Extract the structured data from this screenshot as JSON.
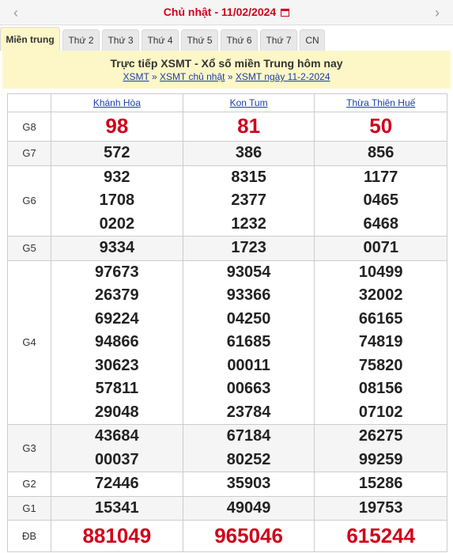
{
  "datebar": {
    "text": "Chủ nhật -  11/02/2024",
    "prev": "‹",
    "next": "›"
  },
  "tabs": [
    "Miền trung",
    "Thứ 2",
    "Thứ 3",
    "Thứ 4",
    "Thứ 5",
    "Thứ 6",
    "Thứ 7",
    "CN"
  ],
  "header": {
    "title": "Trực tiếp XSMT - Xổ số miền Trung hôm nay",
    "crumbs": [
      "XSMT",
      "XSMT chủ nhật",
      "XSMT ngày 11-2-2024"
    ],
    "sep": "»"
  },
  "provinces": [
    "Khánh Hòa",
    "Kon Tum",
    "Thừa Thiên Huế"
  ],
  "prizes": [
    {
      "label": "G8",
      "values": [
        [
          "98"
        ],
        [
          "81"
        ],
        [
          "50"
        ]
      ]
    },
    {
      "label": "G7",
      "values": [
        [
          "572"
        ],
        [
          "386"
        ],
        [
          "856"
        ]
      ]
    },
    {
      "label": "G6",
      "values": [
        [
          "932",
          "1708",
          "0202"
        ],
        [
          "8315",
          "2377",
          "1232"
        ],
        [
          "1177",
          "0465",
          "6468"
        ]
      ]
    },
    {
      "label": "G5",
      "values": [
        [
          "9334"
        ],
        [
          "1723"
        ],
        [
          "0071"
        ]
      ]
    },
    {
      "label": "G4",
      "values": [
        [
          "97673",
          "26379",
          "69224",
          "94866",
          "30623",
          "57811",
          "29048"
        ],
        [
          "93054",
          "93366",
          "04250",
          "61685",
          "00011",
          "00663",
          "23784"
        ],
        [
          "10499",
          "32002",
          "66165",
          "74819",
          "75820",
          "08156",
          "07102"
        ]
      ]
    },
    {
      "label": "G3",
      "values": [
        [
          "43684",
          "00037"
        ],
        [
          "67184",
          "80252"
        ],
        [
          "26275",
          "99259"
        ]
      ]
    },
    {
      "label": "G2",
      "values": [
        [
          "72446"
        ],
        [
          "35903"
        ],
        [
          "15286"
        ]
      ]
    },
    {
      "label": "G1",
      "values": [
        [
          "15341"
        ],
        [
          "49049"
        ],
        [
          "19753"
        ]
      ]
    },
    {
      "label": "ĐB",
      "values": [
        [
          "881049"
        ],
        [
          "965046"
        ],
        [
          "615244"
        ]
      ]
    }
  ]
}
